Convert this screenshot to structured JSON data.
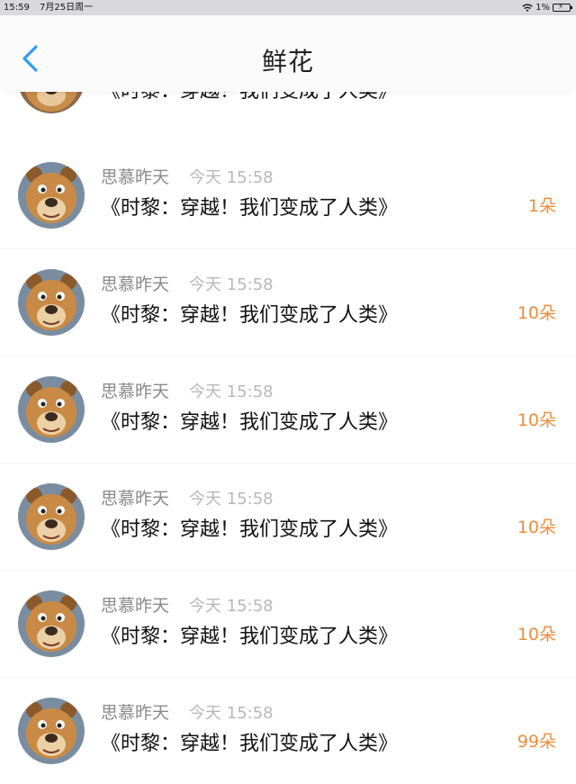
{
  "status_bar": {
    "time": "15:59",
    "date": "7月25日周一",
    "battery": "1%"
  },
  "header": {
    "title": "鲜花",
    "back_icon": "chevron-left-icon"
  },
  "colors": {
    "accent": "#2f9cf5",
    "count": "#f08c3a"
  },
  "items": [
    {
      "book": "《时黎：穿越！我们变成了人类》"
    },
    {
      "name": "思慕昨天",
      "time": "今天 15:58",
      "book": "《时黎：穿越！我们变成了人类》",
      "count": "1朵"
    },
    {
      "name": "思慕昨天",
      "time": "今天 15:58",
      "book": "《时黎：穿越！我们变成了人类》",
      "count": "10朵"
    },
    {
      "name": "思慕昨天",
      "time": "今天 15:58",
      "book": "《时黎：穿越！我们变成了人类》",
      "count": "10朵"
    },
    {
      "name": "思慕昨天",
      "time": "今天 15:58",
      "book": "《时黎：穿越！我们变成了人类》",
      "count": "10朵"
    },
    {
      "name": "思慕昨天",
      "time": "今天 15:58",
      "book": "《时黎：穿越！我们变成了人类》",
      "count": "10朵"
    },
    {
      "name": "思慕昨天",
      "time": "今天 15:58",
      "book": "《时黎：穿越！我们变成了人类》",
      "count": "99朵"
    }
  ]
}
